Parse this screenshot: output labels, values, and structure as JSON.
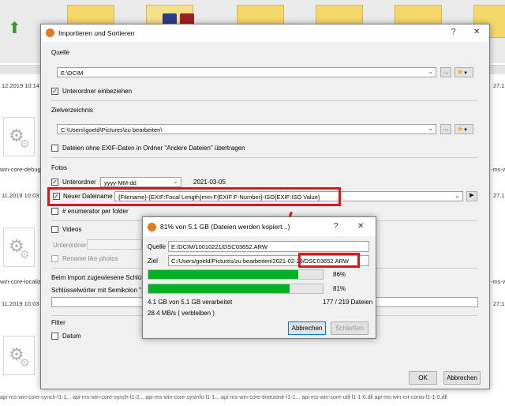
{
  "background": {
    "row_dates": [
      "12.2019 10:14",
      "11.2019 10:03",
      "11.2019 10:03"
    ],
    "row_dates_right": [
      "27.1",
      "27.1",
      "27.1"
    ],
    "file_labels": [
      "win-core-debug",
      "win-core-localiz"
    ],
    "file_labels_right": [
      "-ms-w",
      "-ms-w"
    ],
    "bottom_strip": "api-ms-win-core-synch-l1-1...   api-ms-win-core-synch-l1-2...   api-ms-win-core-sysinfo-l1-1...   api-ms-win-core-timezone-l1-1...   api-ms-win-core-util-l1-1-0.dll   api-ms-win-crt-conio-l1-1-0.dll"
  },
  "main_dialog": {
    "title": "Importieren und Sortieren",
    "help": "?",
    "close": "✕",
    "source": {
      "label": "Quelle",
      "path": "E:\\DCIM",
      "browse": "...",
      "include_subfolders": "Unterordner einbeziehen",
      "include_subfolders_checked": true
    },
    "target": {
      "label": "Zielverzeichnis",
      "path": "C:\\Users\\goeld\\Pictures\\zu bearbeiten\\",
      "browse": "...",
      "no_exif": "Dateien ohne EXIF-Daten in Ordner \"Andere Dateien\" übertragen",
      "no_exif_checked": false
    },
    "photos": {
      "label": "Fotos",
      "subfolder_label": "Unterordner",
      "subfolder_checked": true,
      "subfolder_format": "yyyy-MM-dd",
      "subfolder_preview": "2021-03-05",
      "new_filename_label": "Neuer Dateiname",
      "new_filename_checked": true,
      "new_filename_pattern": "{Filename}-{EXIF:Focal Length}mm-F{EXIF:F-Number}-ISO{EXIF:ISO Value}",
      "play": "▶",
      "enumerator_label": "# enumerator per folder",
      "enumerator_checked": false
    },
    "videos": {
      "label": "Videos",
      "checked": false,
      "subfolder_label": "Unterordner",
      "rename_label": "Rename like photos"
    },
    "keywords": {
      "label": "Beim Import zugewiesene Schlüsse",
      "hint": "Schlüsselwörter mit Semikolon \";\""
    },
    "filter": {
      "label": "Filter",
      "date_label": "Datum",
      "date_checked": false
    },
    "ok": "OK",
    "cancel": "Abbrechen"
  },
  "progress_dialog": {
    "title": "81% von 5.1 GB (Dateien werden kopiert...)",
    "help": "?",
    "close": "✕",
    "source_label": "Quelle",
    "source_value": "E:/DCIM/10010221/DSC03652.ARW",
    "target_label": "Ziel",
    "target_value": "C:/Users/goeld/Pictures/zu bearbeiten/2021-02-23/DSC03652.ARW",
    "bar1_percent": 86,
    "bar1_text": "86%",
    "bar2_percent": 81,
    "bar2_text": "81%",
    "processed": "4.1 GB von 5.1 GB verarbeitet",
    "file_count": "177 / 219 Dateien",
    "speed": "28.4 MB/s (  verbleiben )",
    "cancel": "Abbrechen",
    "close_btn": "Schließen"
  },
  "colors": {
    "highlight": "#e0141c",
    "progress": "#06b025",
    "folder": "#f5d86a"
  },
  "icons": [
    "folder-icon",
    "up-arrow-icon",
    "gear-icon",
    "star-icon",
    "app-icon",
    "play-icon"
  ]
}
